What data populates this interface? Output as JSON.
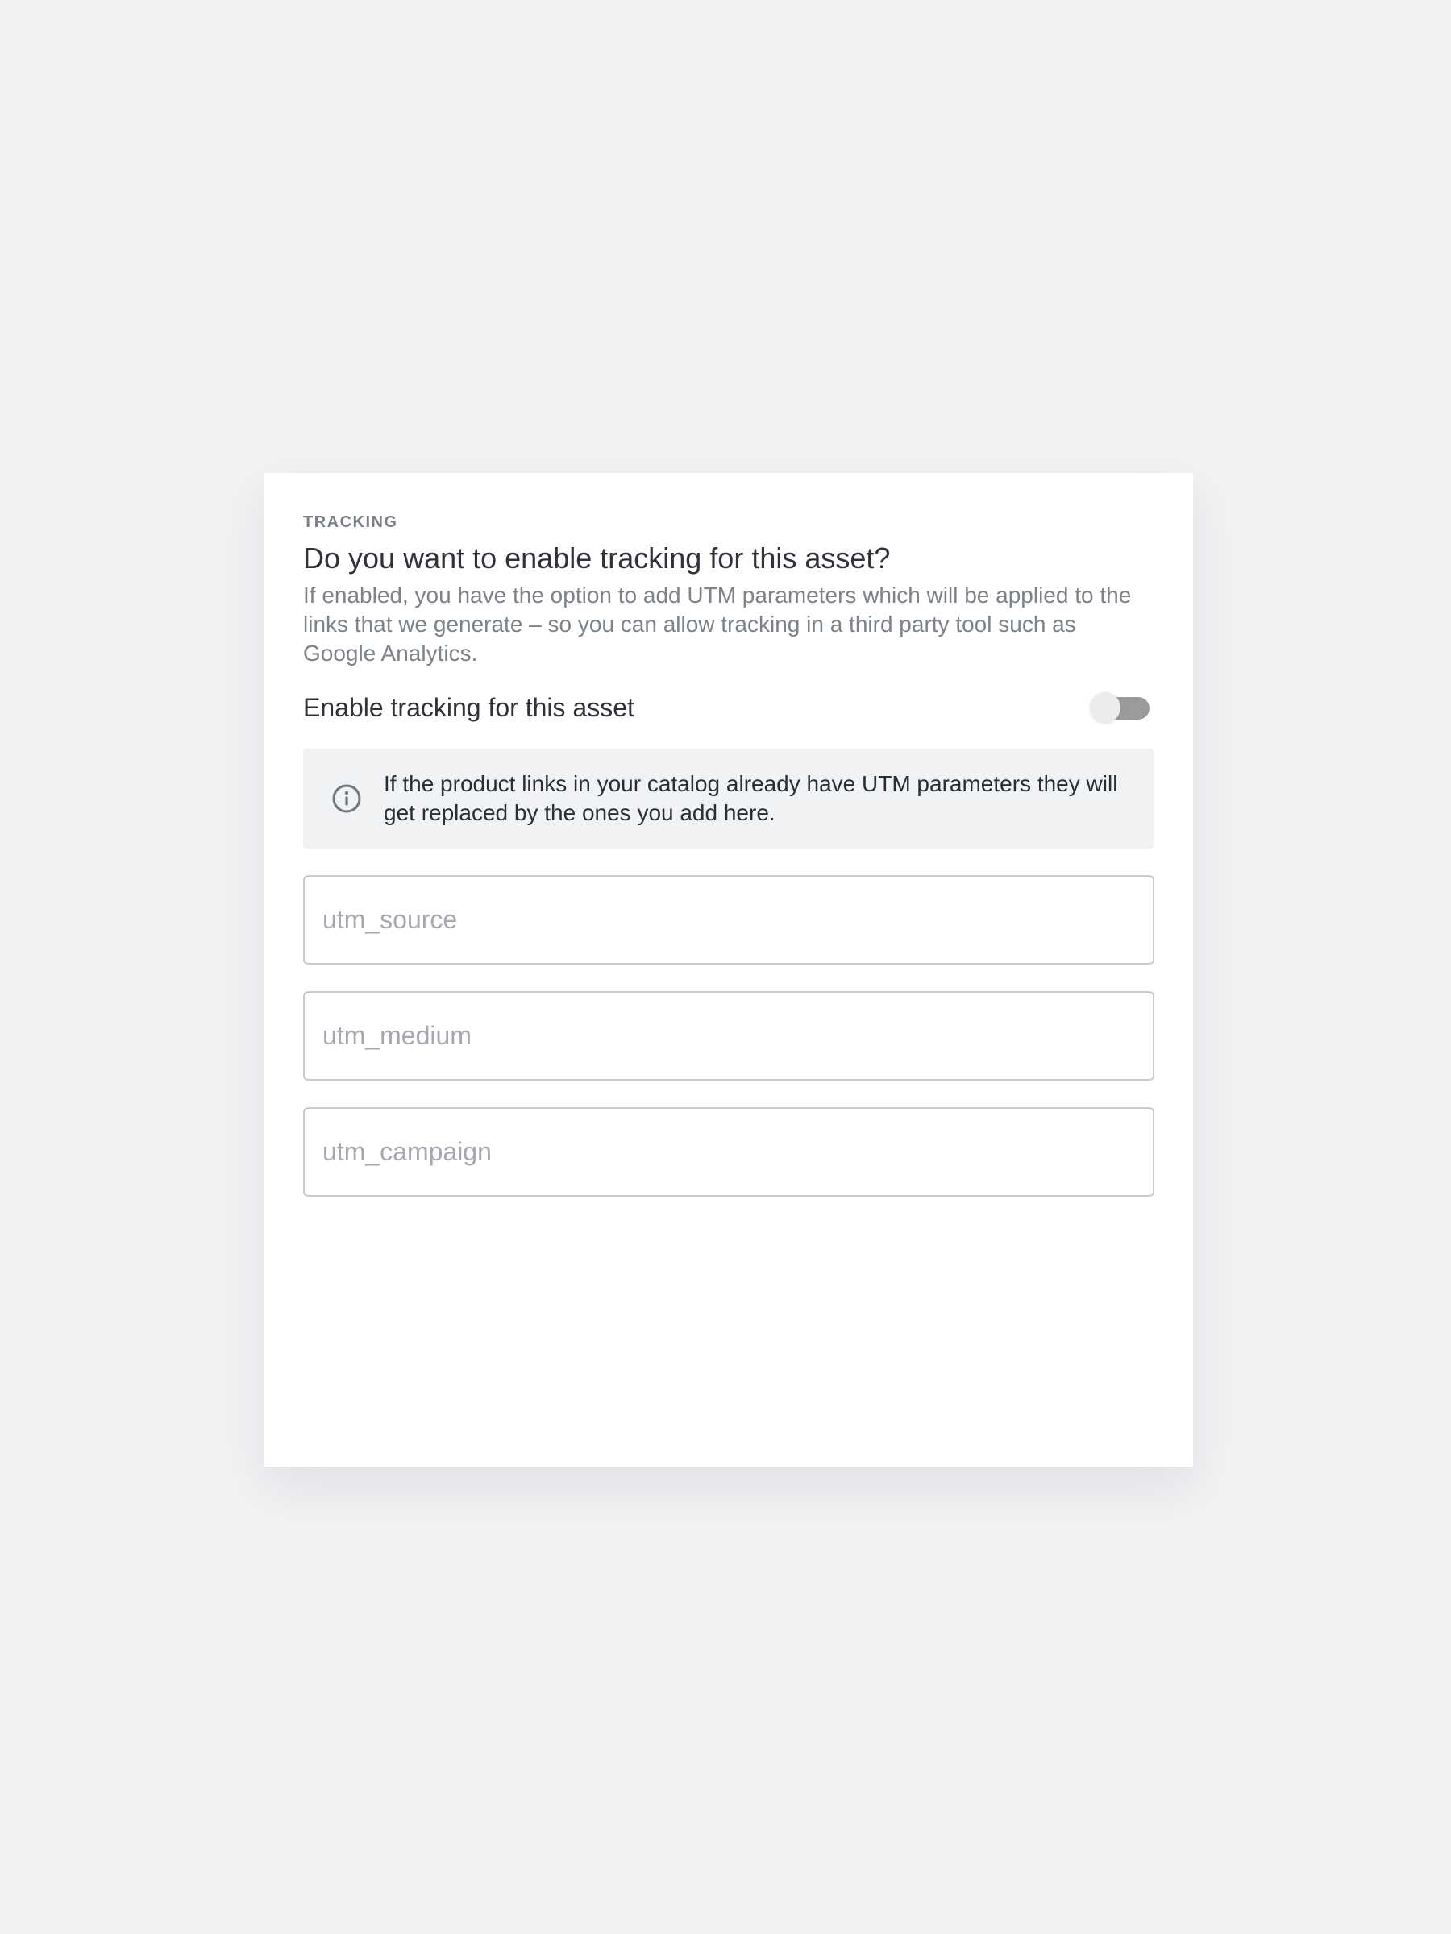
{
  "section": {
    "eyebrow": "TRACKING",
    "title": "Do you want to enable tracking for this asset?",
    "description": "If enabled, you have the option to add UTM parameters which will be applied to the links that we generate – so you can allow tracking in a third party tool such as Google Analytics."
  },
  "toggle": {
    "label": "Enable tracking for this asset",
    "enabled": false
  },
  "info": {
    "icon": "info-icon",
    "text": "If the product links in your catalog already have UTM parameters they will get replaced by the ones you add here."
  },
  "fields": {
    "utm_source": {
      "placeholder": "utm_source",
      "value": ""
    },
    "utm_medium": {
      "placeholder": "utm_medium",
      "value": ""
    },
    "utm_campaign": {
      "placeholder": "utm_campaign",
      "value": ""
    }
  },
  "colors": {
    "background": "#f1f2f4",
    "card": "#ffffff",
    "toggle_track": "#9b9b9b",
    "toggle_knob": "#ececec",
    "info_box": "#f1f2f4"
  }
}
